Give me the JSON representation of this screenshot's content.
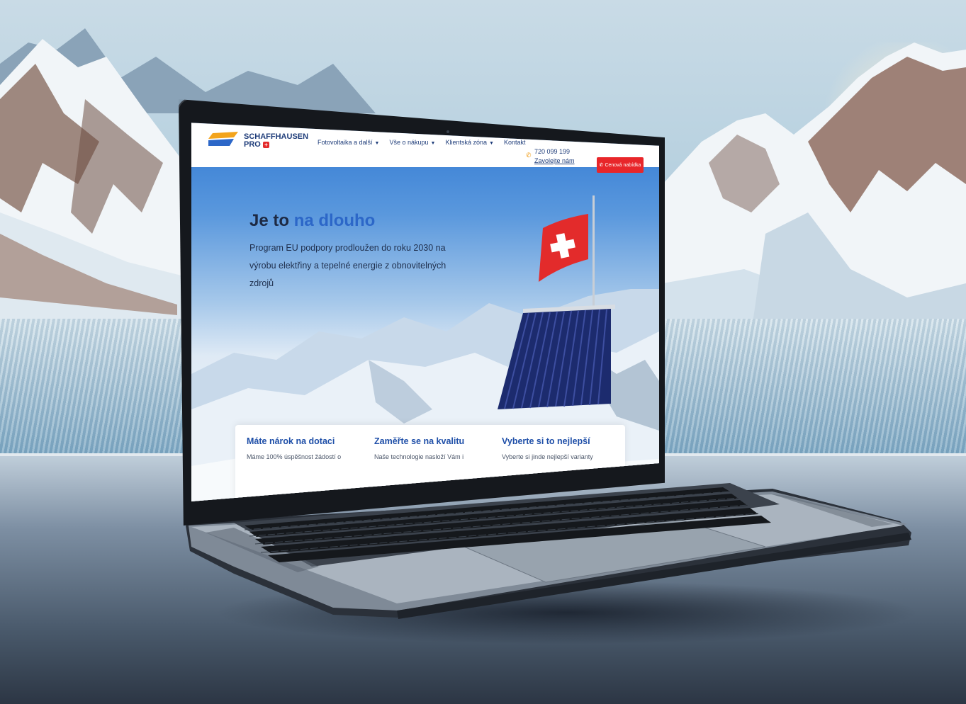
{
  "colors": {
    "brand_primary": "#1f3d7a",
    "brand_accent": "#2c67c8",
    "cta": "#e8262a",
    "flag_red": "#e32b2b"
  },
  "site": {
    "logo": {
      "name": "SCHAFFHAUSEN",
      "suffix": "PRO"
    },
    "nav": [
      {
        "label": "Fotovoltaika a další",
        "has_dropdown": true
      },
      {
        "label": "Vše o nákupu",
        "has_dropdown": true
      },
      {
        "label": "Klientská zóna",
        "has_dropdown": true
      },
      {
        "label": "Kontakt",
        "has_dropdown": false
      }
    ],
    "phone": {
      "number": "720 099 199",
      "call_label": "Zavolejte nám",
      "icon": "phone-icon"
    },
    "cta_label": "Cenová nabídka",
    "cta_icon": "chat-icon",
    "hero": {
      "title_plain": "Je to",
      "title_accent": "na dlouho",
      "subtitle": "Program EU podpory prodloužen do roku 2030 na výrobu elektřiny a tepelné energie z obnovitelných zdrojů"
    },
    "cards": [
      {
        "title": "Máte nárok na dotaci",
        "text": "Máme 100% úspěšnost žádostí o"
      },
      {
        "title": "Zaměřte se na kvalitu",
        "text": "Naše technologie nasloží Vám i"
      },
      {
        "title": "Vyberte si to nejlepší",
        "text": "Vyberte si jinde nejlepší varianty"
      }
    ]
  }
}
